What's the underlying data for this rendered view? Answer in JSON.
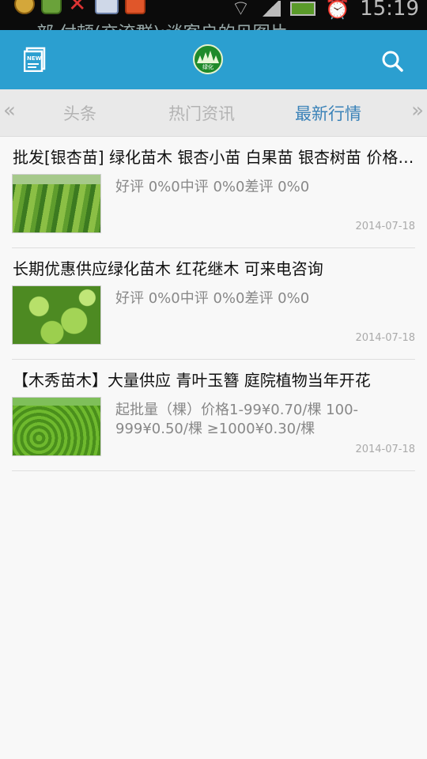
{
  "status_bar": {
    "ticker": "一部  付顿(交流群):谈客户的见图片",
    "time": "15:19"
  },
  "appbar": {
    "news_icon": "news-icon",
    "logo_icon": "tree-logo-icon",
    "logo_label": "绿化",
    "search_icon": "search-icon",
    "accent": "#2b9fd0"
  },
  "tabs": {
    "items": [
      {
        "label": "头条"
      },
      {
        "label": "热门资讯"
      },
      {
        "label": "最新行情"
      }
    ],
    "active_index": 2,
    "active_color": "#3a82b8"
  },
  "items": [
    {
      "title": "批发[银杏苗] 绿化苗木 银杏小苗 白果苗 银杏树苗 价格优惠",
      "desc": "好评  0%0中评 0%0差评 0%0",
      "date": "2014-07-18"
    },
    {
      "title": "长期优惠供应绿化苗木 红花继木 可来电咨询",
      "desc": "好评  0%0中评 0%0差评 0%0",
      "date": "2014-07-18"
    },
    {
      "title": "【木秀苗木】大量供应 青叶玉簪 庭院植物当年开花",
      "desc": "起批量（棵）价格1-99¥0.70/棵  100-999¥0.50/棵 ≥1000¥0.30/棵",
      "date": "2014-07-18"
    }
  ]
}
